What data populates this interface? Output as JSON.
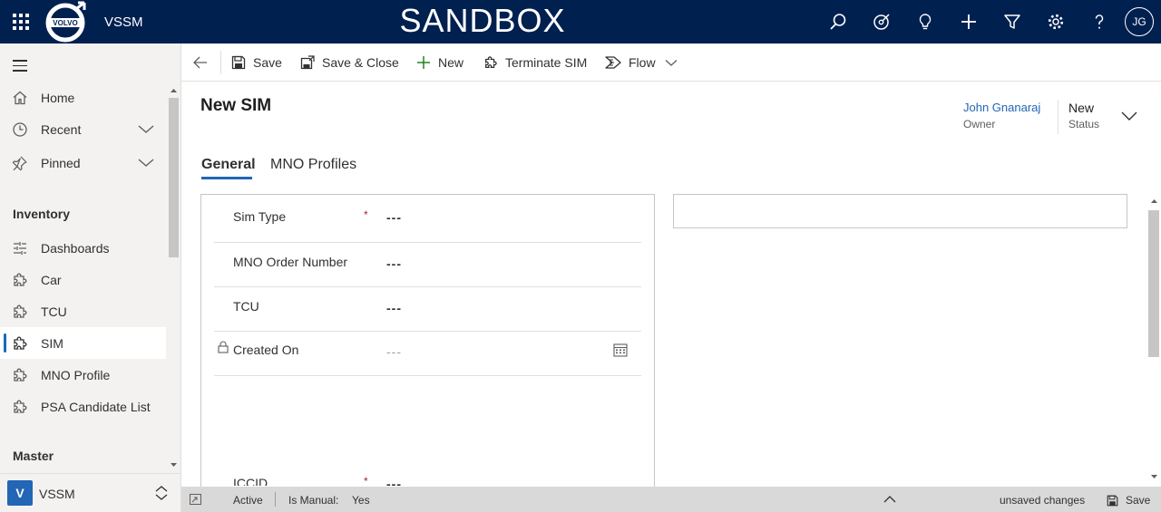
{
  "topbar": {
    "app_name": "VSSM",
    "environment": "SANDBOX",
    "logo": "volvo-logo",
    "icons": [
      "search-icon",
      "assistant-icon",
      "lightbulb-icon",
      "plus-icon",
      "filter-icon",
      "gear-icon",
      "help-icon"
    ],
    "user_initials": "JG",
    "color": "#002050"
  },
  "sidebar": {
    "items": [
      {
        "label": "Home",
        "icon": "home-icon"
      },
      {
        "label": "Recent",
        "icon": "clock-icon"
      },
      {
        "label": "Pinned",
        "icon": "pin-icon"
      }
    ],
    "groups": [
      {
        "title": "Inventory",
        "items": [
          {
            "label": "Dashboards",
            "icon": "dashboard-icon"
          },
          {
            "label": "Car",
            "icon": "puzzle-icon"
          },
          {
            "label": "TCU",
            "icon": "puzzle-icon"
          },
          {
            "label": "SIM",
            "icon": "puzzle-icon",
            "active": true
          },
          {
            "label": "MNO Profile",
            "icon": "puzzle-icon"
          },
          {
            "label": "PSA Candidate List",
            "icon": "puzzle-icon"
          }
        ]
      },
      {
        "title": "Master",
        "items": []
      }
    ],
    "area": {
      "badge": "V",
      "name": "VSSM",
      "badge_color": "#2266b5"
    }
  },
  "commandbar": {
    "save": "Save",
    "save_close": "Save & Close",
    "new": "New",
    "terminate": "Terminate SIM",
    "flow": "Flow"
  },
  "header": {
    "title": "New SIM",
    "owner_name": "John Gnanaraj",
    "owner_label": "Owner",
    "status_value": "New",
    "status_label": "Status"
  },
  "tabs": [
    {
      "label": "General",
      "active": true
    },
    {
      "label": "MNO Profiles",
      "active": false
    }
  ],
  "form": {
    "fields": [
      {
        "label": "Sim Type",
        "required": true,
        "value": "---"
      },
      {
        "label": "MNO Order Number",
        "required": false,
        "value": "---"
      },
      {
        "label": "TCU",
        "required": false,
        "value": "---"
      },
      {
        "label": "Created On",
        "required": false,
        "value": "---",
        "locked": true
      },
      {
        "label": "ICCID",
        "required": true,
        "value": "---"
      }
    ],
    "required_mark": "*"
  },
  "footer": {
    "state": "Active",
    "is_manual_label": "Is Manual:",
    "is_manual_value": "Yes",
    "unsaved": "unsaved changes",
    "save": "Save"
  }
}
